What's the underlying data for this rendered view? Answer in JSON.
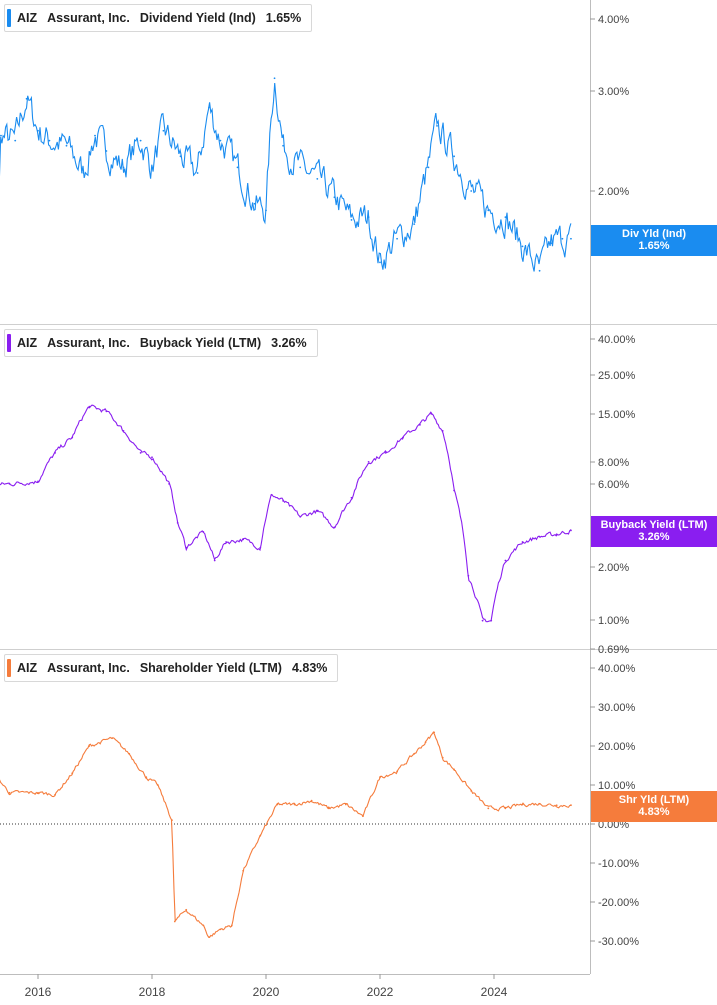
{
  "x_axis_labels": [
    "2016",
    "2018",
    "2020",
    "2022",
    "2024"
  ],
  "chart_data": [
    {
      "type": "line",
      "ticker": "AIZ",
      "company": "Assurant, Inc.",
      "metric": "Dividend Yield (Ind)",
      "current_value": "1.65%",
      "flag_label": "Div Yld (Ind)",
      "flag_value": "1.65%",
      "color": "#1a8cf0",
      "scale": "log",
      "ylim": [
        1.2,
        4.6
      ],
      "y_ticks": [
        "4.00%",
        "3.00%",
        "2.00%"
      ],
      "x": [
        2015.0,
        2015.3,
        2015.35,
        2015.6,
        2015.8,
        2016.0,
        2016.2,
        2016.5,
        2016.8,
        2017.0,
        2017.2,
        2017.5,
        2017.8,
        2018.0,
        2018.2,
        2018.5,
        2018.8,
        2019.0,
        2019.2,
        2019.5,
        2019.8,
        2020.0,
        2020.15,
        2020.3,
        2020.6,
        2020.9,
        2021.2,
        2021.5,
        2021.8,
        2022.0,
        2022.3,
        2022.6,
        2022.85,
        2023.0,
        2023.3,
        2023.6,
        2023.9,
        2024.2,
        2024.5,
        2024.8,
        2025.0,
        2025.2,
        2025.35
      ],
      "values": [
        2.02,
        1.7,
        2.5,
        2.45,
        2.9,
        2.55,
        2.45,
        2.4,
        2.15,
        2.5,
        2.35,
        2.2,
        2.45,
        2.2,
        2.55,
        2.3,
        2.15,
        2.8,
        2.45,
        2.2,
        1.9,
        1.85,
        3.15,
        2.4,
        2.2,
        2.1,
        1.95,
        1.78,
        1.8,
        1.5,
        1.65,
        1.75,
        2.2,
        2.6,
        2.3,
        2.0,
        1.85,
        1.8,
        1.6,
        1.45,
        1.62,
        1.65,
        1.65
      ]
    },
    {
      "type": "line",
      "ticker": "AIZ",
      "company": "Assurant, Inc.",
      "metric": "Buyback Yield (LTM)",
      "current_value": "3.26%",
      "flag_label": "Buyback Yield (LTM)",
      "flag_value": "3.26%",
      "color": "#8a1ef0",
      "scale": "log",
      "ylim": [
        0.69,
        40
      ],
      "y_ticks": [
        "40.00%",
        "25.00%",
        "15.00%",
        "8.00%",
        "6.00%",
        "2.00%",
        "1.00%",
        "0.69%"
      ],
      "x": [
        2015.0,
        2015.5,
        2016.0,
        2016.3,
        2016.6,
        2016.9,
        2017.2,
        2017.5,
        2017.8,
        2018.0,
        2018.3,
        2018.45,
        2018.6,
        2018.9,
        2019.1,
        2019.3,
        2019.6,
        2019.9,
        2020.1,
        2020.3,
        2020.6,
        2020.9,
        2021.2,
        2021.5,
        2021.8,
        2022.1,
        2022.4,
        2022.7,
        2022.9,
        2023.1,
        2023.3,
        2023.55,
        2023.8,
        2023.95,
        2024.2,
        2024.5,
        2024.8,
        2025.1,
        2025.35
      ],
      "values": [
        5.8,
        6.0,
        6.2,
        9.0,
        11.0,
        16.5,
        15.5,
        12.0,
        9.0,
        8.5,
        6.0,
        3.6,
        2.6,
        3.2,
        2.2,
        2.8,
        2.9,
        2.6,
        5.2,
        4.8,
        3.9,
        4.2,
        3.4,
        5.0,
        8.0,
        9.0,
        11.0,
        13.0,
        15.0,
        12.0,
        5.5,
        1.8,
        1.0,
        1.0,
        2.2,
        2.8,
        3.0,
        3.1,
        3.26
      ]
    },
    {
      "type": "line",
      "ticker": "AIZ",
      "company": "Assurant, Inc.",
      "metric": "Shareholder Yield (LTM)",
      "current_value": "4.83%",
      "flag_label": "Shr Yld (LTM)",
      "flag_value": "4.83%",
      "color": "#f57c3c",
      "scale": "linear",
      "ylim": [
        -38,
        42
      ],
      "y_ticks": [
        "40.00%",
        "30.00%",
        "20.00%",
        "10.00%",
        "0.00%",
        "-10.00%",
        "-20.00%",
        "-30.00%"
      ],
      "x": [
        2015.0,
        2015.5,
        2016.0,
        2016.3,
        2016.6,
        2016.9,
        2017.3,
        2017.6,
        2017.9,
        2018.1,
        2018.35,
        2018.4,
        2018.6,
        2018.9,
        2019.0,
        2019.2,
        2019.4,
        2019.6,
        2019.9,
        2020.2,
        2020.5,
        2020.8,
        2021.1,
        2021.4,
        2021.7,
        2022.0,
        2022.3,
        2022.6,
        2022.8,
        2022.95,
        2023.1,
        2023.3,
        2023.6,
        2023.9,
        2024.2,
        2024.5,
        2024.8,
        2025.1,
        2025.35
      ],
      "values": [
        17.0,
        8.0,
        8.0,
        7.5,
        13.0,
        20.0,
        22.0,
        18.0,
        12.0,
        10.0,
        1.0,
        -25.0,
        -22.0,
        -26.0,
        -29.0,
        -27.0,
        -26.0,
        -12.0,
        -3.0,
        5.0,
        5.0,
        6.0,
        4.0,
        5.0,
        2.0,
        12.0,
        13.5,
        18.0,
        21.0,
        23.5,
        17.0,
        14.0,
        8.5,
        4.0,
        4.0,
        5.0,
        5.2,
        4.8,
        4.83
      ]
    }
  ]
}
